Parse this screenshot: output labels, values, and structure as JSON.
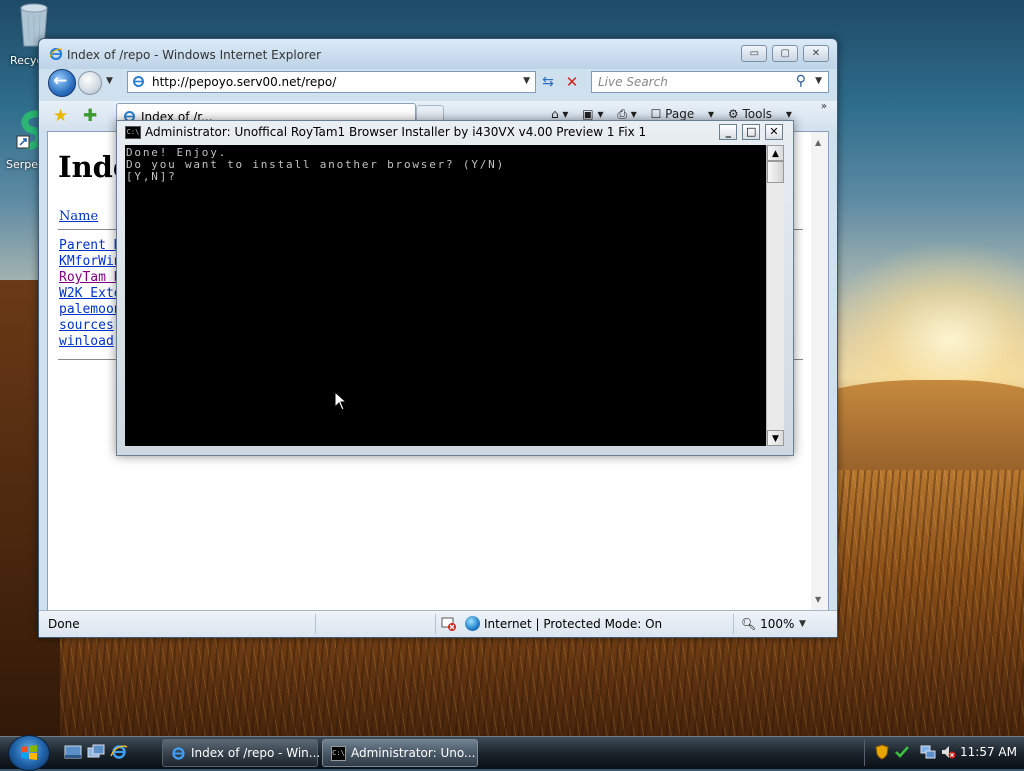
{
  "desktop": {
    "icons": [
      {
        "label": "Recycle Bin",
        "visible_label": "Recyc"
      },
      {
        "label": "Serpent",
        "visible_label": "Serpe"
      }
    ]
  },
  "ie_window": {
    "title": "Index of /repo - Windows Internet Explorer",
    "address": "http://pepoyo.serv00.net/repo/",
    "search_placeholder": "Live Search",
    "tab_label": "Index of /r...",
    "command_bar": {
      "page": "Page",
      "tools": "Tools"
    },
    "content": {
      "heading": "Inde",
      "name_column": "Name",
      "links": [
        {
          "text": "Parent D",
          "visited": false
        },
        {
          "text": "KMforWin",
          "visited": false
        },
        {
          "text": "RoyTam B",
          "visited": true
        },
        {
          "text": "W2K Exte",
          "visited": false
        },
        {
          "text": "palemoon",
          "visited": false
        },
        {
          "text": "sources",
          "visited": false
        },
        {
          "text": "winload",
          "visited": false
        }
      ]
    },
    "status": {
      "left": "Done",
      "zone": "Internet | Protected Mode: On",
      "zoom": "100%"
    }
  },
  "console_window": {
    "title": "Administrator:  Unoffical RoyTam1 Browser Installer by i430VX v4.00 Preview 1 Fix 1",
    "output": "Done! Enjoy.\nDo you want to install another browser? (Y/N)\n[Y,N]?"
  },
  "taskbar": {
    "tasks": [
      {
        "label": "Index of /repo - Win...",
        "active": false
      },
      {
        "label": "Administrator:  Uno...",
        "active": true
      }
    ],
    "clock": "11:57 AM"
  },
  "icons": {
    "ie": "internet-explorer-icon",
    "cmd": "command-prompt-icon",
    "recycle": "recycle-bin-icon"
  }
}
